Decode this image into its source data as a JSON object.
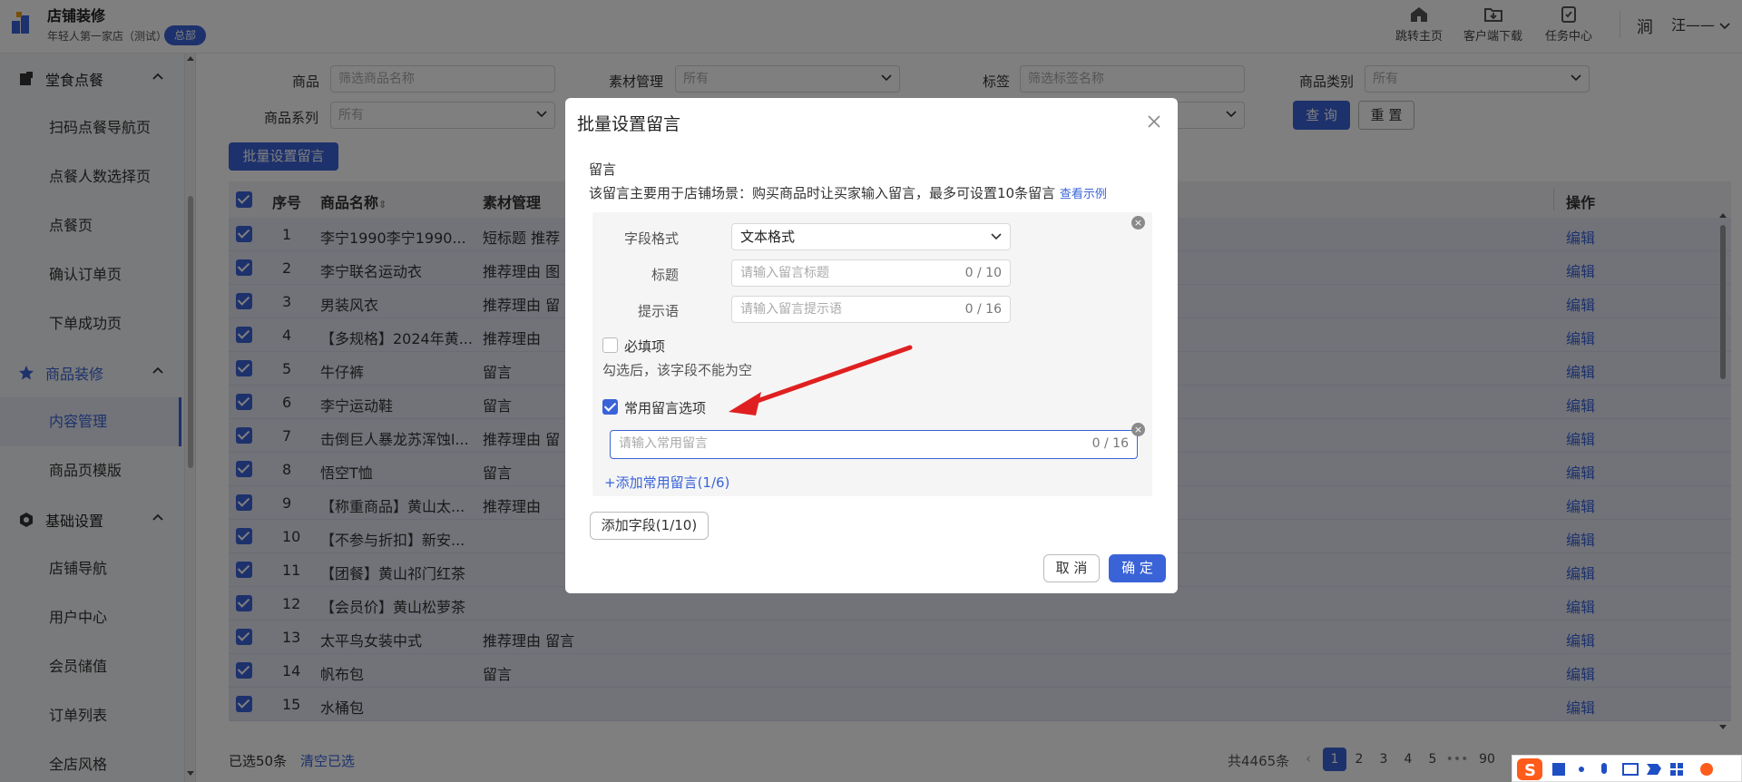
{
  "header": {
    "store_name": "店铺装修",
    "store_sub": "年轻人第一家店（测试）",
    "badge": "总部",
    "actions": [
      {
        "label": "跳转主页",
        "icon": "home-icon"
      },
      {
        "label": "客户端下载",
        "icon": "download-icon"
      },
      {
        "label": "任务中心",
        "icon": "task-icon"
      }
    ],
    "user": "汪——"
  },
  "sidebar": {
    "groups": [
      {
        "label": "堂食点餐",
        "icon": "meal-icon"
      },
      {
        "label": "商品装修",
        "icon": "star-icon"
      },
      {
        "label": "基础设置",
        "icon": "settings-icon"
      }
    ],
    "items": [
      {
        "label": "扫码点餐导航页"
      },
      {
        "label": "点餐人数选择页"
      },
      {
        "label": "点餐页"
      },
      {
        "label": "确认订单页"
      },
      {
        "label": "下单成功页"
      },
      {
        "label": "内容管理"
      },
      {
        "label": "商品页模版"
      },
      {
        "label": "店铺导航"
      },
      {
        "label": "用户中心"
      },
      {
        "label": "会员储值"
      },
      {
        "label": "订单列表"
      },
      {
        "label": "全店风格"
      }
    ]
  },
  "filters": {
    "product_label": "商品",
    "product_placeholder": "筛选商品名称",
    "material_label": "素材管理",
    "material_value": "所有",
    "tag_label": "标签",
    "tag_placeholder": "筛选标签名称",
    "category_label": "商品类别",
    "category_value": "所有",
    "series_label": "商品系列",
    "series_value": "所有",
    "query_btn": "查 询",
    "reset_btn": "重 置",
    "batch_btn": "批量设置留言"
  },
  "table": {
    "headers": {
      "index": "序号",
      "name": "商品名称",
      "material": "素材管理",
      "action": "操作"
    },
    "edit_label": "编辑",
    "rows": [
      {
        "i": "1",
        "name": "李宁1990李宁1990...",
        "material": "短标题  推荐"
      },
      {
        "i": "2",
        "name": "李宁联名运动衣",
        "material": "推荐理由  图"
      },
      {
        "i": "3",
        "name": "男装风衣",
        "material": "推荐理由  留"
      },
      {
        "i": "4",
        "name": "【多规格】2024年黄...",
        "material": "推荐理由"
      },
      {
        "i": "5",
        "name": "牛仔裤",
        "material": "留言"
      },
      {
        "i": "6",
        "name": "李宁运动鞋",
        "material": "留言"
      },
      {
        "i": "7",
        "name": "击倒巨人暴龙苏浑蚀l...",
        "material": "推荐理由  留"
      },
      {
        "i": "8",
        "name": "悟空T恤",
        "material": "留言"
      },
      {
        "i": "9",
        "name": "【称重商品】黄山太...",
        "material": "推荐理由"
      },
      {
        "i": "10",
        "name": "【不参与折扣】新安...",
        "material": ""
      },
      {
        "i": "11",
        "name": "【团餐】黄山祁门红茶",
        "material": ""
      },
      {
        "i": "12",
        "name": "【会员价】黄山松萝茶",
        "material": ""
      },
      {
        "i": "13",
        "name": "太平鸟女装中式",
        "material": "推荐理由  留言"
      },
      {
        "i": "14",
        "name": "帆布包",
        "material": "留言"
      },
      {
        "i": "15",
        "name": "水桶包",
        "material": ""
      }
    ]
  },
  "footer": {
    "selected": "已选50条",
    "clear": "清空已选",
    "total": "共4465条",
    "pages": [
      "1",
      "2",
      "3",
      "4",
      "5",
      "•••",
      "90"
    ]
  },
  "modal": {
    "title": "批量设置留言",
    "section_label": "留言",
    "section_desc": "该留言主要用于店铺场景：购买商品时让买家输入留言，最多可设置10条留言",
    "example_link": "查看示例",
    "field_format_label": "字段格式",
    "field_format_value": "文本格式",
    "title_label": "标题",
    "title_placeholder": "请输入留言标题",
    "title_count": "0 / 10",
    "hint_label": "提示语",
    "hint_placeholder": "请输入留言提示语",
    "hint_count": "0 / 16",
    "required_label": "必填项",
    "required_desc": "勾选后，该字段不能为空",
    "common_label": "常用留言选项",
    "common_placeholder": "请输入常用留言",
    "common_count": "0 / 16",
    "add_common": "+添加常用留言(1/6)",
    "add_field": "添加字段(1/10)",
    "cancel": "取 消",
    "confirm": "确 定"
  },
  "colors": {
    "accent": "#3a63d8",
    "annotation_arrow": "#e02020"
  }
}
